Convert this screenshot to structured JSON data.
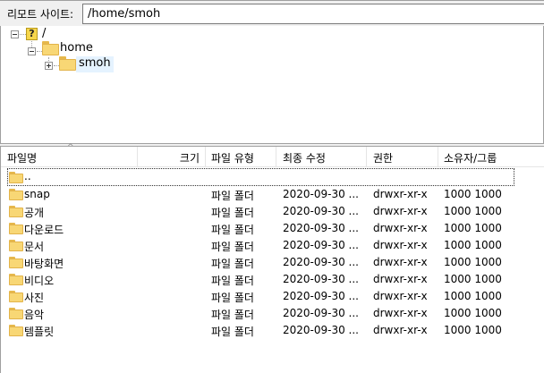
{
  "remote_site": {
    "label": "리모트 사이트:",
    "path": "/home/smoh"
  },
  "tree": {
    "root_label": "/",
    "home_label": "home",
    "smoh_label": "smoh"
  },
  "columns": {
    "name": "파일명",
    "size": "크기",
    "type": "파일 유형",
    "modified": "최종 수정",
    "permissions": "권한",
    "owner": "소유자/그룹"
  },
  "parent_entry": "..",
  "files": [
    {
      "name": "snap",
      "size": "",
      "type": "파일 폴더",
      "modified": "2020-09-30 ...",
      "permissions": "drwxr-xr-x",
      "owner": "1000 1000"
    },
    {
      "name": "공개",
      "size": "",
      "type": "파일 폴더",
      "modified": "2020-09-30 ...",
      "permissions": "drwxr-xr-x",
      "owner": "1000 1000"
    },
    {
      "name": "다운로드",
      "size": "",
      "type": "파일 폴더",
      "modified": "2020-09-30 ...",
      "permissions": "drwxr-xr-x",
      "owner": "1000 1000"
    },
    {
      "name": "문서",
      "size": "",
      "type": "파일 폴더",
      "modified": "2020-09-30 ...",
      "permissions": "drwxr-xr-x",
      "owner": "1000 1000"
    },
    {
      "name": "바탕화면",
      "size": "",
      "type": "파일 폴더",
      "modified": "2020-09-30 ...",
      "permissions": "drwxr-xr-x",
      "owner": "1000 1000"
    },
    {
      "name": "비디오",
      "size": "",
      "type": "파일 폴더",
      "modified": "2020-09-30 ...",
      "permissions": "drwxr-xr-x",
      "owner": "1000 1000"
    },
    {
      "name": "사진",
      "size": "",
      "type": "파일 폴더",
      "modified": "2020-09-30 ...",
      "permissions": "drwxr-xr-x",
      "owner": "1000 1000"
    },
    {
      "name": "음악",
      "size": "",
      "type": "파일 폴더",
      "modified": "2020-09-30 ...",
      "permissions": "drwxr-xr-x",
      "owner": "1000 1000"
    },
    {
      "name": "템플릿",
      "size": "",
      "type": "파일 폴더",
      "modified": "2020-09-30 ...",
      "permissions": "drwxr-xr-x",
      "owner": "1000 1000"
    }
  ],
  "icons": {
    "folder": "folder-icon",
    "unknown_root": "question-icon",
    "expand": "expand-icon",
    "collapse": "collapse-icon",
    "sort": "sort-ascending-icon"
  },
  "colors": {
    "folder_fill": "#f8d775",
    "folder_border": "#e2b34a",
    "selected_bg": "#e5f3ff"
  }
}
